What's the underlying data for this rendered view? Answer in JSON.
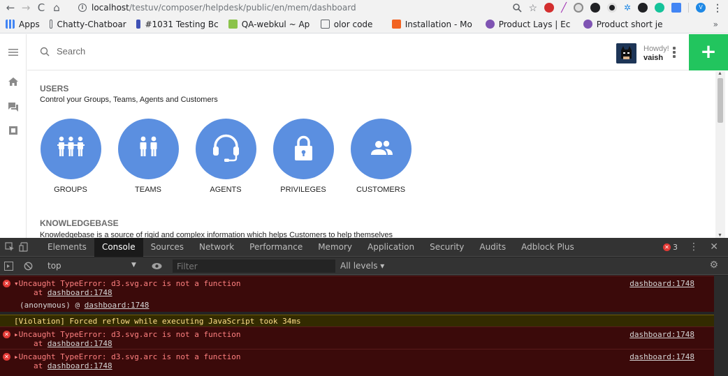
{
  "browser": {
    "url_host": "localhost",
    "url_path": "/testuv/composer/helpdesk/public/en/mem/dashboard",
    "profile_initial": "V",
    "bookmarks": [
      "Apps",
      "Chatty-Chatboar",
      "#1031 Testing Bc",
      "QA-webkul ~ Ap",
      "olor code",
      "Installation - Mo",
      "Product Lays | Ec",
      "Product short je"
    ],
    "overflow": "»"
  },
  "app": {
    "search_placeholder": "Search",
    "howdy": "Howdy!",
    "username": "vaish",
    "add_label": "+",
    "users_section": {
      "title": "USERS",
      "description": "Control your Groups, Teams, Agents and Customers",
      "tiles": [
        "GROUPS",
        "TEAMS",
        "AGENTS",
        "PRIVILEGES",
        "CUSTOMERS"
      ]
    },
    "kb_section": {
      "title": "KNOWLEDGEBASE",
      "description": "Knowledgebase is a source of rigid and complex information which helps Customers to help themselves"
    }
  },
  "devtools": {
    "tabs": [
      "Elements",
      "Console",
      "Sources",
      "Network",
      "Performance",
      "Memory",
      "Application",
      "Security",
      "Audits",
      "Adblock Plus"
    ],
    "active_tab": "Console",
    "error_count": "3",
    "context": "top",
    "filter_placeholder": "Filter",
    "levels": "All levels ▾",
    "messages": [
      {
        "type": "error",
        "expanded": true,
        "text": "Uncaught TypeError: d3.svg.arc is not a function",
        "at": "at ",
        "at_link": "dashboard:1748",
        "source": "dashboard:1748",
        "stack": "(anonymous) @ ",
        "stack_link": "dashboard:1748"
      },
      {
        "type": "warning",
        "text": "[Violation] Forced reflow while executing JavaScript took 34ms"
      },
      {
        "type": "error",
        "expanded": false,
        "text": "Uncaught TypeError: d3.svg.arc is not a function",
        "at": "at ",
        "at_link": "dashboard:1748",
        "source": "dashboard:1748"
      },
      {
        "type": "error",
        "expanded": false,
        "text": "Uncaught TypeError: d3.svg.arc is not a function",
        "at": "at ",
        "at_link": "dashboard:1748",
        "source": "dashboard:1748"
      }
    ]
  },
  "colors": {
    "tile_blue": "#5b8fe0",
    "add_green": "#22c55e",
    "console_error_bg": "#3b0a0a",
    "console_warn_bg": "#332b00"
  }
}
